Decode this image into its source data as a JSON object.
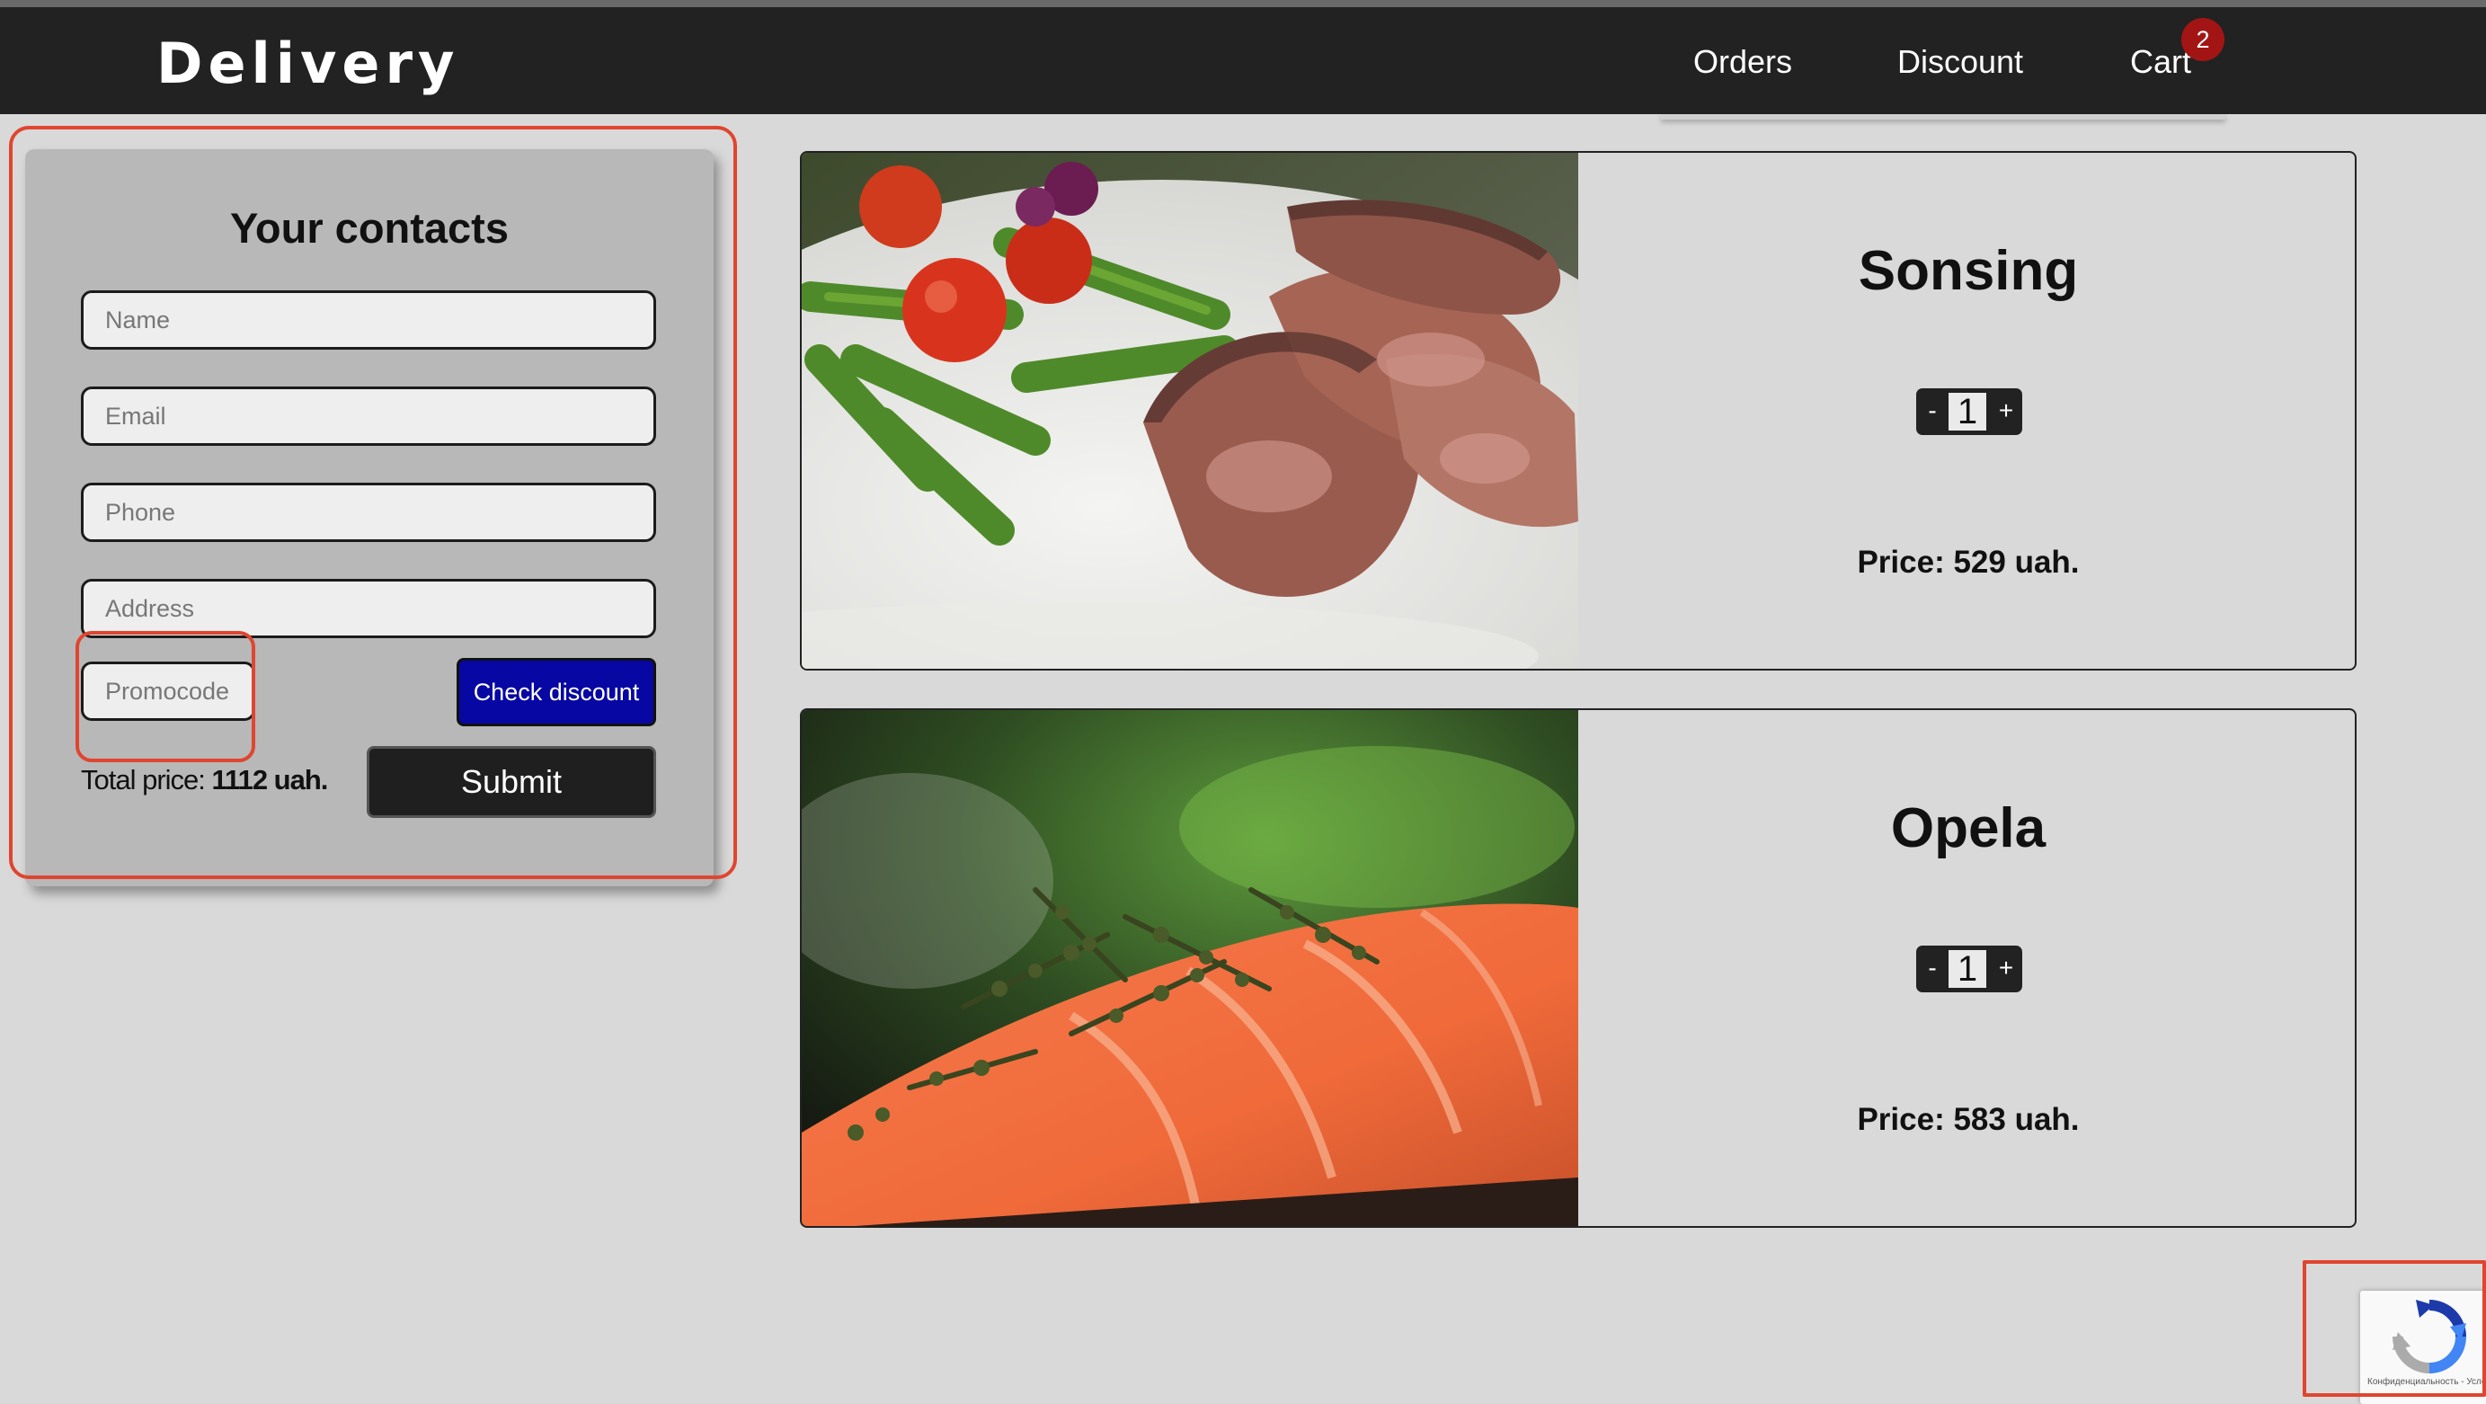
{
  "header": {
    "brand": "Delivery",
    "nav": {
      "orders": "Orders",
      "discount": "Discount",
      "cart": "Cart",
      "cart_count": "2"
    }
  },
  "contacts": {
    "title": "Your contacts",
    "fields": {
      "name_placeholder": "Name",
      "email_placeholder": "Email",
      "phone_placeholder": "Phone",
      "address_placeholder": "Address",
      "promo_placeholder": "Promocode"
    },
    "check_discount_label": "Check discount",
    "total_label": "Total price:",
    "total_value": "1112 uah.",
    "submit_label": "Submit"
  },
  "products": [
    {
      "name": "Sonsing",
      "quantity": "1",
      "minus": "-",
      "plus": "+",
      "price": "Price: 529 uah.",
      "image": "steak-with-asparagus-photo"
    },
    {
      "name": "Opela",
      "quantity": "1",
      "minus": "-",
      "plus": "+",
      "price": "Price: 583 uah.",
      "image": "salmon-fillet-photo"
    }
  ],
  "recaptcha": {
    "text": "Конфиденциальность - Условия использования"
  },
  "colors": {
    "navbar": "#222222",
    "page_bg": "#d9d9d9",
    "card_bg": "#b8b8b8",
    "check_button": "#0707a3",
    "submit_button": "#1f1f1f",
    "cart_badge": "#a31515",
    "annotation": "#e0452f"
  }
}
